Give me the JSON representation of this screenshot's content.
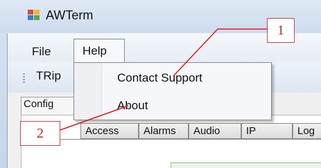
{
  "window": {
    "title": "AWTerm",
    "icon": "app-window-icon"
  },
  "menu": {
    "items": [
      "File",
      "Help"
    ],
    "open_menu": "Help",
    "help_items": [
      "Contact Support",
      "About"
    ]
  },
  "toolbar": {
    "partial_label": "TRip"
  },
  "config": {
    "tab_label": "Config"
  },
  "tabs": [
    "Access",
    "Alarms",
    "Audio",
    "IP",
    "Log"
  ],
  "callouts": {
    "one": "1",
    "two": "2"
  },
  "colors": {
    "callout_border": "#c64848",
    "callout_text": "#b22525",
    "leader_line": "#e11d1d"
  }
}
